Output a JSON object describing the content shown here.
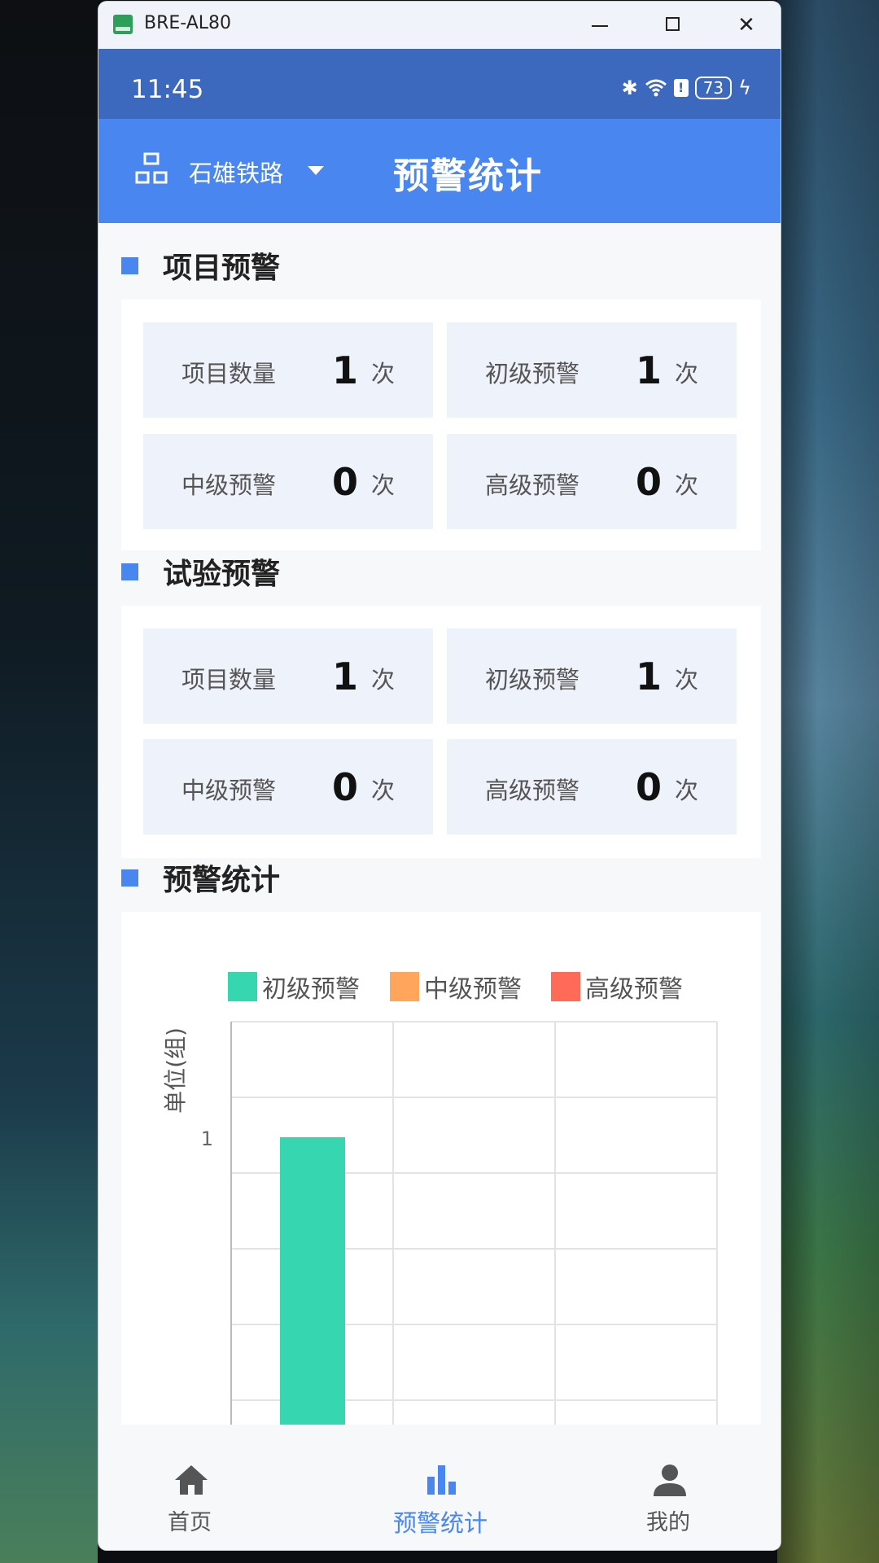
{
  "window": {
    "title": "BRE-AL80"
  },
  "status_bar": {
    "time": "11:45",
    "battery": "73"
  },
  "app_bar": {
    "org_name": "石雄铁路",
    "page_title": "预警统计"
  },
  "sections": {
    "project": {
      "title": "项目预警",
      "tiles": [
        {
          "label": "项目数量",
          "value": "1",
          "unit": "次"
        },
        {
          "label": "初级预警",
          "value": "1",
          "unit": "次"
        },
        {
          "label": "中级预警",
          "value": "0",
          "unit": "次"
        },
        {
          "label": "高级预警",
          "value": "0",
          "unit": "次"
        }
      ]
    },
    "test": {
      "title": "试验预警",
      "tiles": [
        {
          "label": "项目数量",
          "value": "1",
          "unit": "次"
        },
        {
          "label": "初级预警",
          "value": "1",
          "unit": "次"
        },
        {
          "label": "中级预警",
          "value": "0",
          "unit": "次"
        },
        {
          "label": "高级预警",
          "value": "0",
          "unit": "次"
        }
      ]
    },
    "stats": {
      "title": "预警统计"
    }
  },
  "chart_data": {
    "type": "bar",
    "ylabel": "单位(组)",
    "yticks": [
      "1"
    ],
    "ylim": [
      0,
      1.3
    ],
    "categories": [
      "",
      "",
      ""
    ],
    "series": [
      {
        "name": "初级预警",
        "color": "#35d6b0",
        "values": [
          1,
          0,
          0
        ]
      },
      {
        "name": "中级预警",
        "color": "#ffa55c",
        "values": [
          0,
          0,
          0
        ]
      },
      {
        "name": "高级预警",
        "color": "#ff6b57",
        "values": [
          0,
          0,
          0
        ]
      }
    ],
    "grid": true,
    "legend_position": "top"
  },
  "bottom_nav": [
    {
      "label": "首页",
      "icon": "home-icon",
      "active": false
    },
    {
      "label": "预警统计",
      "icon": "bar-chart-icon",
      "active": true
    },
    {
      "label": "我的",
      "icon": "user-icon",
      "active": false
    }
  ],
  "colors": {
    "primary": "#4a86f0",
    "status_bar": "#3c68bd",
    "tile_bg": "#eef3fb"
  }
}
